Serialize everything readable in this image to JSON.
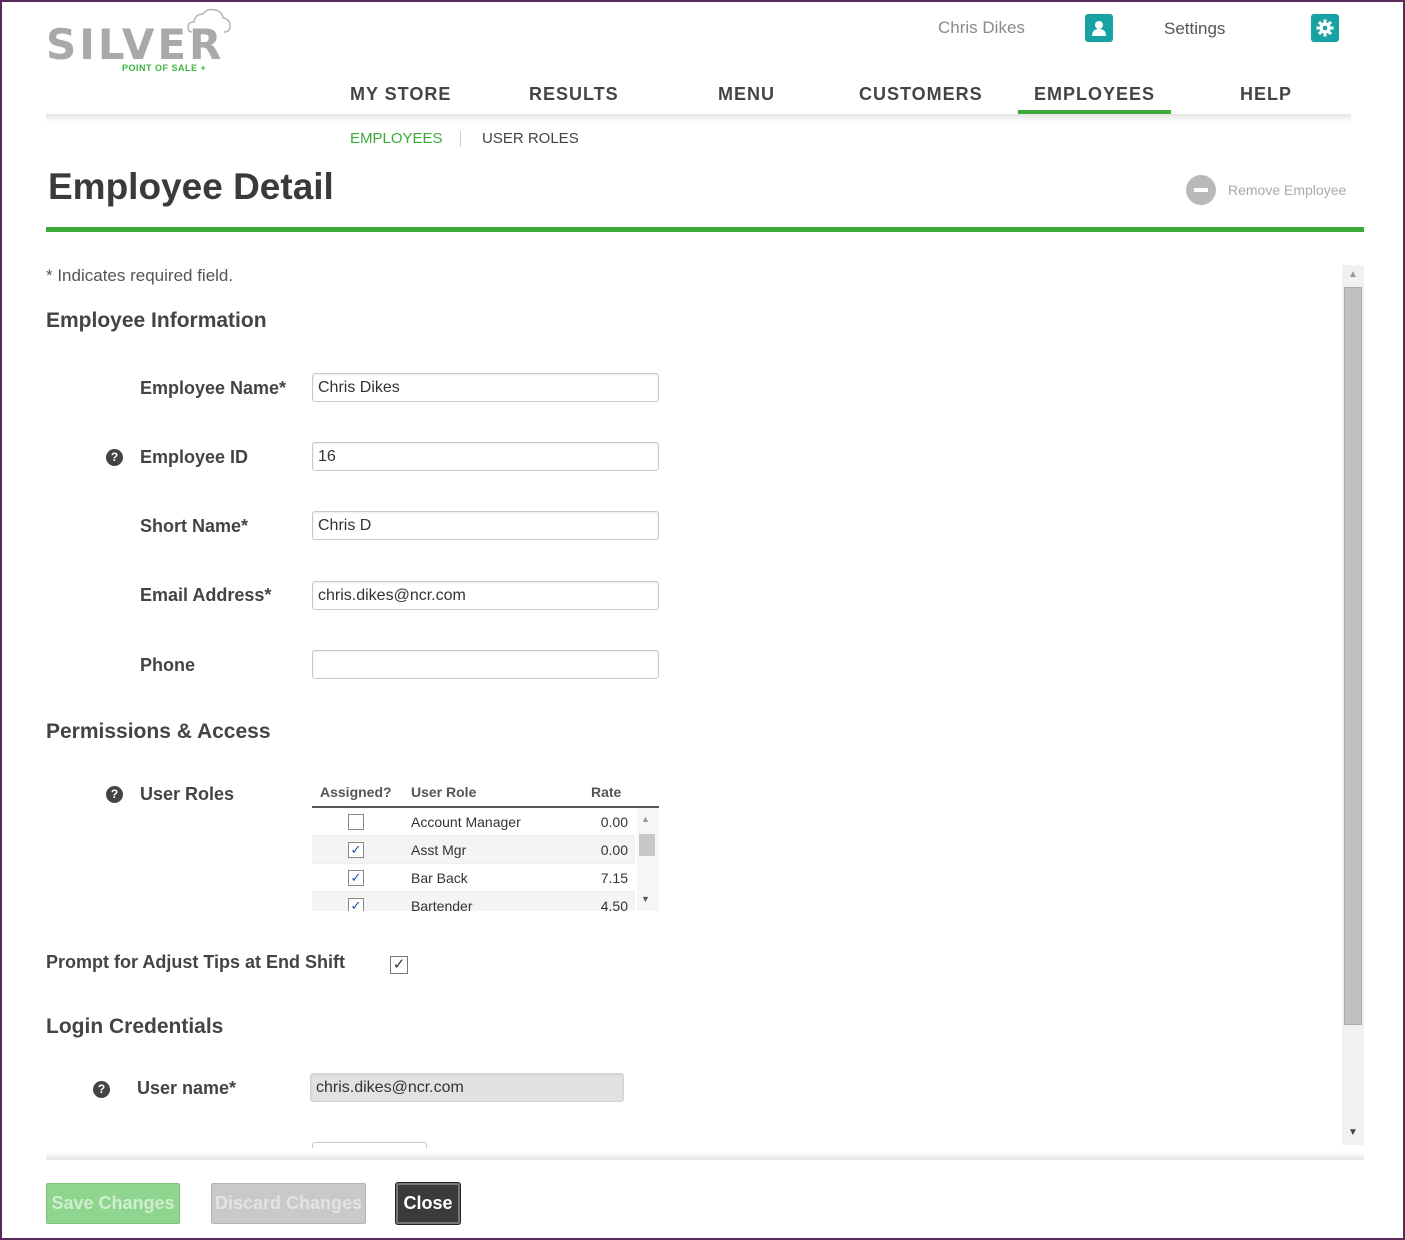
{
  "brand": {
    "name": "SILVER",
    "tagline": "POINT OF SALE +"
  },
  "header": {
    "user_name": "Chris Dikes",
    "user_icon": "person-icon",
    "settings_label": "Settings",
    "settings_icon": "gear-icon",
    "accent_color": "#17a2a4"
  },
  "nav": {
    "items": [
      {
        "label": "MY STORE"
      },
      {
        "label": "RESULTS"
      },
      {
        "label": "MENU"
      },
      {
        "label": "CUSTOMERS"
      },
      {
        "label": "EMPLOYEES",
        "active": true
      },
      {
        "label": "HELP"
      }
    ],
    "active_color": "#3aaa3a"
  },
  "subnav": {
    "items": [
      {
        "label": "EMPLOYEES",
        "active": true
      },
      {
        "label": "USER ROLES"
      }
    ]
  },
  "page": {
    "title": "Employee Detail",
    "remove_label": "Remove Employee",
    "required_note": "* Indicates required field."
  },
  "employee_info": {
    "section_title": "Employee Information",
    "fields": [
      {
        "label": "Employee Name*",
        "value": "Chris Dikes"
      },
      {
        "label": "Employee ID",
        "value": "16",
        "help": true
      },
      {
        "label": "Short Name*",
        "value": "Chris D"
      },
      {
        "label": "Email Address*",
        "value": "chris.dikes@ncr.com"
      },
      {
        "label": "Phone",
        "value": ""
      }
    ]
  },
  "permissions": {
    "section_title": "Permissions & Access",
    "user_roles_label": "User Roles",
    "columns": [
      "Assigned?",
      "User Role",
      "Rate"
    ],
    "roles": [
      {
        "assigned": false,
        "name": "Account Manager",
        "rate": "0.00"
      },
      {
        "assigned": true,
        "name": "Asst Mgr",
        "rate": "0.00"
      },
      {
        "assigned": true,
        "name": "Bar Back",
        "rate": "7.15"
      },
      {
        "assigned": true,
        "name": "Bartender",
        "rate": "4.50"
      }
    ],
    "tips_label": "Prompt for Adjust Tips at End Shift",
    "tips_checked": true
  },
  "login": {
    "section_title": "Login Credentials",
    "username_label": "User name*",
    "username_value": "chris.dikes@ncr.com"
  },
  "footer": {
    "save_label": "Save Changes",
    "discard_label": "Discard Changes",
    "close_label": "Close"
  }
}
